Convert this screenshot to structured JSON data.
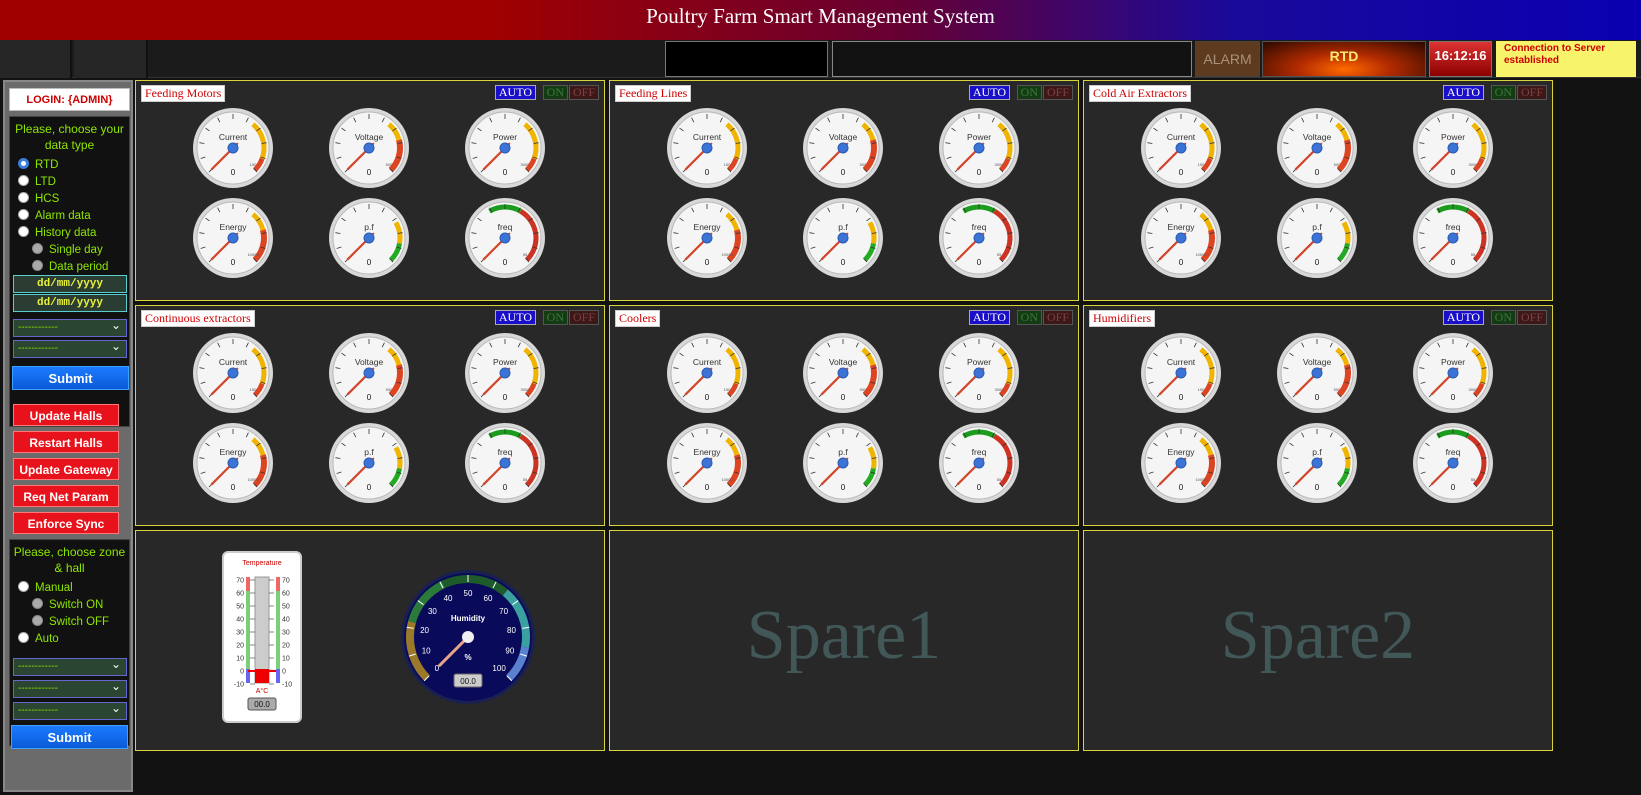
{
  "header": {
    "title": "Poultry Farm Smart Management System"
  },
  "status": {
    "alarm": "ALARM",
    "mode": "RTD",
    "time": "16:12:16",
    "connection": "Connection to Server established"
  },
  "sidebar": {
    "login": "LOGIN: {ADMIN}",
    "data_type_title": "Please, choose your data type",
    "data_types": [
      "RTD",
      "LTD",
      "HCS",
      "Alarm data",
      "History data"
    ],
    "history_sub": [
      "Single day",
      "Data period"
    ],
    "date_placeholder": "dd/mm/yyyy",
    "select_placeholder": "------------",
    "submit": "Submit",
    "actions": [
      "Update Halls",
      "Restart Halls",
      "Update Gateway",
      "Req Net Param",
      "Enforce Sync"
    ],
    "zone_title": "Please, choose zone & hall",
    "zone_modes": [
      "Manual",
      "Auto"
    ],
    "switch_options": [
      "Switch ON",
      "Switch OFF"
    ]
  },
  "controls": {
    "auto": "AUTO",
    "on": "ON",
    "off": "OFF"
  },
  "gauge_reading": "0",
  "gauges": [
    {
      "label": "Current",
      "max_label": "150",
      "accent": "#f0b400",
      "value": 0
    },
    {
      "label": "Voltage",
      "max_label": "500",
      "accent": "#dd4422",
      "value": 0
    },
    {
      "label": "Power",
      "max_label": "3000",
      "accent": "#f0b400",
      "value": 0
    },
    {
      "label": "Energy",
      "max_label": "10000",
      "accent": "#dd4422",
      "value": 0
    },
    {
      "label": "p.f",
      "max_label": "",
      "accent": "#22aa22",
      "value": 0
    },
    {
      "label": "freq",
      "max_label": "55",
      "accent": "#cc3322",
      "value": 0
    }
  ],
  "cards": [
    {
      "title": "Feeding Motors"
    },
    {
      "title": "Feeding Lines"
    },
    {
      "title": "Cold Air Extractors"
    },
    {
      "title": "Continuous extractors"
    },
    {
      "title": "Coolers"
    },
    {
      "title": "Humidifiers"
    }
  ],
  "temperature": {
    "title": "Temperature",
    "unit": "A°C",
    "ticks": [
      "70",
      "60",
      "50",
      "40",
      "30",
      "20",
      "10",
      "0",
      "-10"
    ],
    "value": "00.0"
  },
  "humidity": {
    "title": "Humidity",
    "unit": "%",
    "ticks": [
      "0",
      "10",
      "20",
      "30",
      "40",
      "50",
      "60",
      "70",
      "80",
      "90",
      "100"
    ],
    "value": "00.0"
  },
  "spares": [
    "Spare1",
    "Spare2"
  ],
  "colors": {
    "card_border": "#d8d23b",
    "accent_green": "#8ee600",
    "danger_red": "#e8121c",
    "auto_blue": "#1a0fc8"
  }
}
